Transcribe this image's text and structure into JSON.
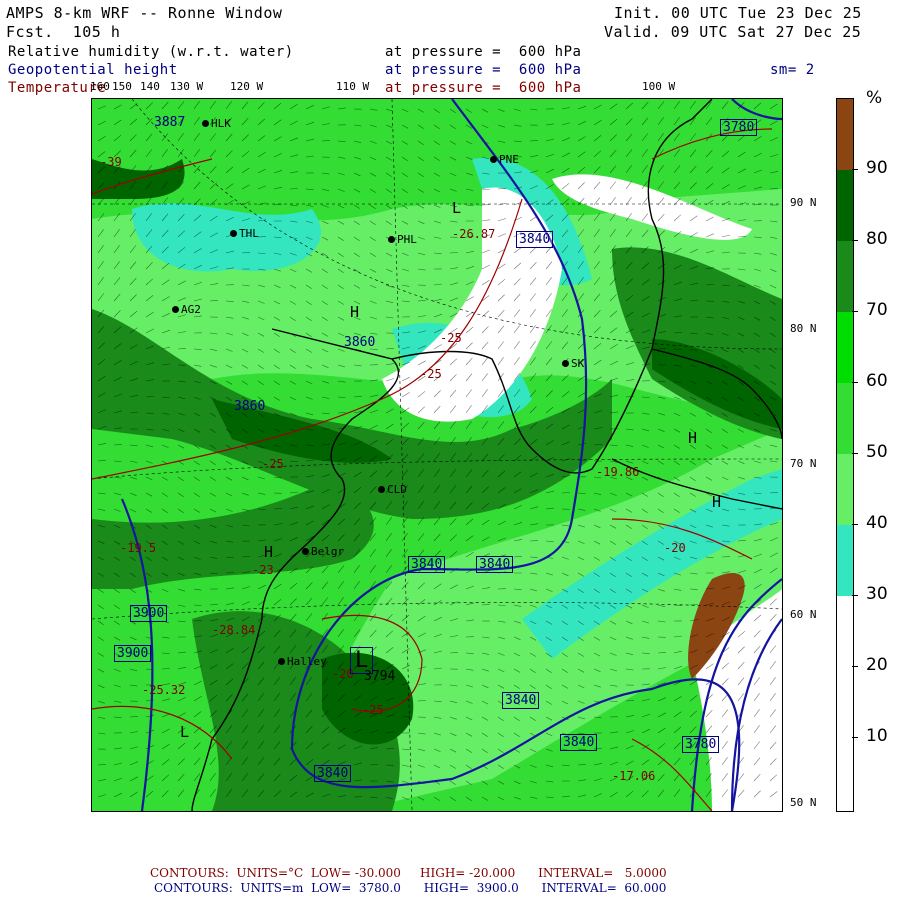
{
  "header": {
    "title": "AMPS 8-km WRF -- Ronne Window",
    "fcst": "Fcst.  105 h",
    "init": "Init. 00 UTC Tue 23 Dec 25",
    "valid": "Valid. 09 UTC Sat 27 Dec 25",
    "field1": "Relative humidity (w.r.t. water)",
    "field2": "Geopotential height",
    "field3": "Temperature",
    "pressure": "at pressure =  600 hPa",
    "sm": "sm= 2"
  },
  "lon_labels": [
    "160",
    "150",
    "140",
    "130 W",
    "120 W",
    "110 W",
    "100 W"
  ],
  "lat_labels": [
    "90 N",
    "80 N",
    "70 N",
    "60 N",
    "50 N"
  ],
  "stations": [
    "HLK",
    "PNE",
    "THL",
    "PHL",
    "AG2",
    "SK",
    "CLD",
    "Belgr",
    "Halley"
  ],
  "height_contours": [
    "3840",
    "3840",
    "3840",
    "3840",
    "3840",
    "3840",
    "3840",
    "3780",
    "3780",
    "3900",
    "3900",
    "3860",
    "3860",
    "3887"
  ],
  "temp_contours": [
    "-25",
    "-25",
    "-25",
    "-25",
    "-20",
    "-20",
    "-26.87",
    "-28.84",
    "-25.32",
    "-17.06",
    "-19.5",
    "-19.86",
    "-39",
    "-23"
  ],
  "lows_highs": [
    "L",
    "H",
    "L",
    "H",
    "L",
    "H",
    "H"
  ],
  "low_value": "3794",
  "colorbar": {
    "unit": "%",
    "labels": [
      "90",
      "80",
      "70",
      "60",
      "50",
      "40",
      "30",
      "20",
      "10"
    ],
    "colors": [
      "#8b4513",
      "#006400",
      "#1a8a1a",
      "#00cc00",
      "#33dd33",
      "#66ee66",
      "#33e6c0",
      "#ffffff",
      "#ffffff",
      "#ffffff"
    ]
  },
  "footer": {
    "line1": {
      "label": "CONTOURS:",
      "units": "UNITS=°C",
      "low": "LOW= -30.000",
      "high": "HIGH= -20.000",
      "interval": "INTERVAL=   5.0000"
    },
    "line2": {
      "label": "CONTOURS:",
      "units": "UNITS=m",
      "low": "LOW=  3780.0",
      "high": "HIGH=  3900.0",
      "interval": "INTERVAL=  60.000"
    }
  }
}
